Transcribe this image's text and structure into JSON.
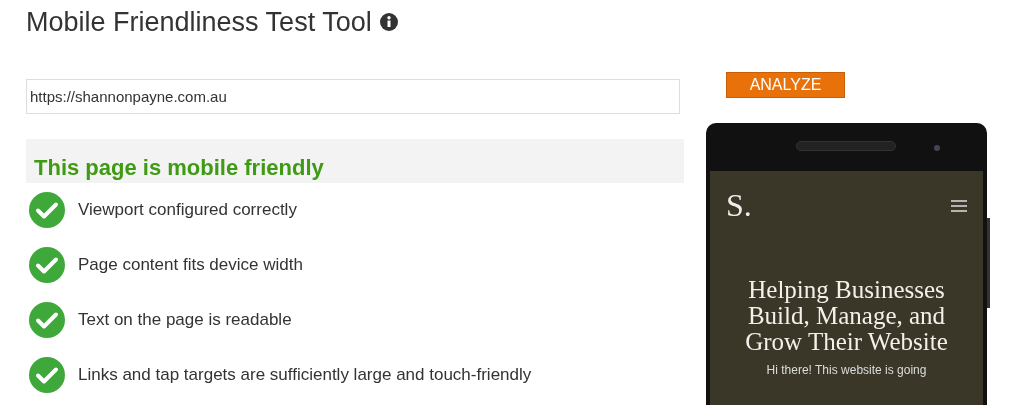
{
  "title": "Mobile Friendliness Test Tool",
  "url_field": {
    "value": "https://shannonpayne.com.au"
  },
  "analyze_button": "ANALYZE",
  "result": {
    "heading": "This page is mobile friendly"
  },
  "checks": [
    {
      "label": "Viewport configured correctly",
      "passed": true
    },
    {
      "label": "Page content fits device width",
      "passed": true
    },
    {
      "label": "Text on the page is readable",
      "passed": true
    },
    {
      "label": "Links and tap targets are sufficiently large and touch-friendly",
      "passed": true
    }
  ],
  "preview": {
    "logo": "S.",
    "headline": "Helping Businesses Build, Manage, and Grow Their Website",
    "intro": "Hi there! This website is going"
  }
}
